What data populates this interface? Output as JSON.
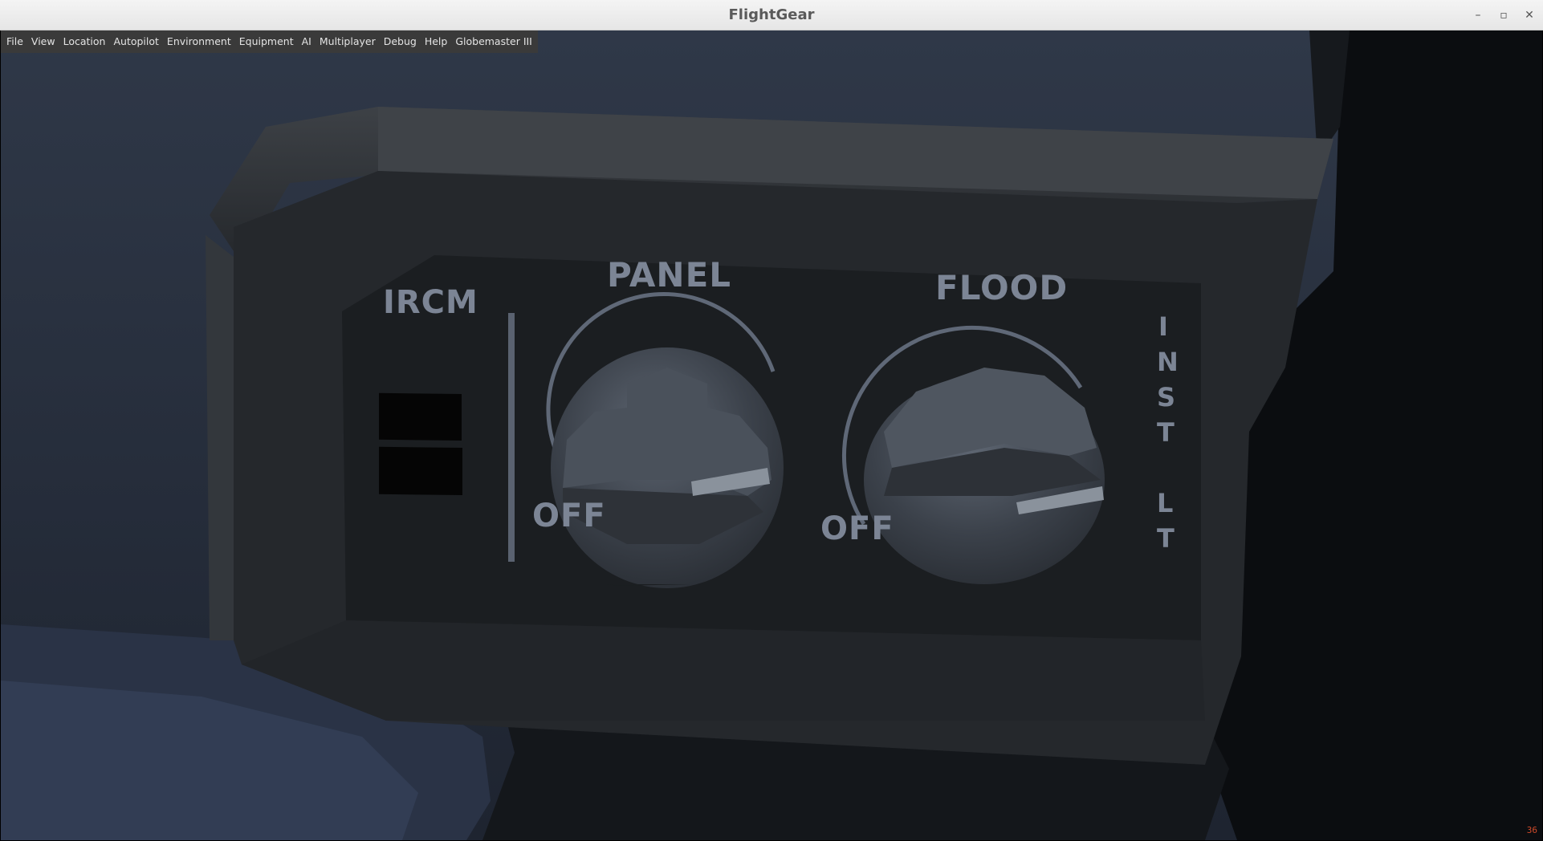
{
  "window": {
    "title": "FlightGear"
  },
  "window_controls": {
    "minimize": "–",
    "maximize": "▫",
    "close": "✕"
  },
  "menubar": {
    "items": [
      {
        "label": "File"
      },
      {
        "label": "View"
      },
      {
        "label": "Location"
      },
      {
        "label": "Autopilot"
      },
      {
        "label": "Environment"
      },
      {
        "label": "Equipment"
      },
      {
        "label": "AI"
      },
      {
        "label": "Multiplayer"
      },
      {
        "label": "Debug"
      },
      {
        "label": "Help"
      },
      {
        "label": "Globemaster III"
      }
    ]
  },
  "cockpit_panel": {
    "ircm_label": "IRCM",
    "panel_knob_label": "PANEL",
    "panel_off_label": "OFF",
    "flood_knob_label": "FLOOD",
    "flood_off_label": "OFF",
    "inst_lt_label": [
      "I",
      "N",
      "S",
      "T",
      "L",
      "T"
    ]
  },
  "fps_counter": "36",
  "colors": {
    "panel_face": "#1b1e21",
    "label": "#7c8595",
    "knob": "#353a41",
    "sky": "#262d39"
  }
}
